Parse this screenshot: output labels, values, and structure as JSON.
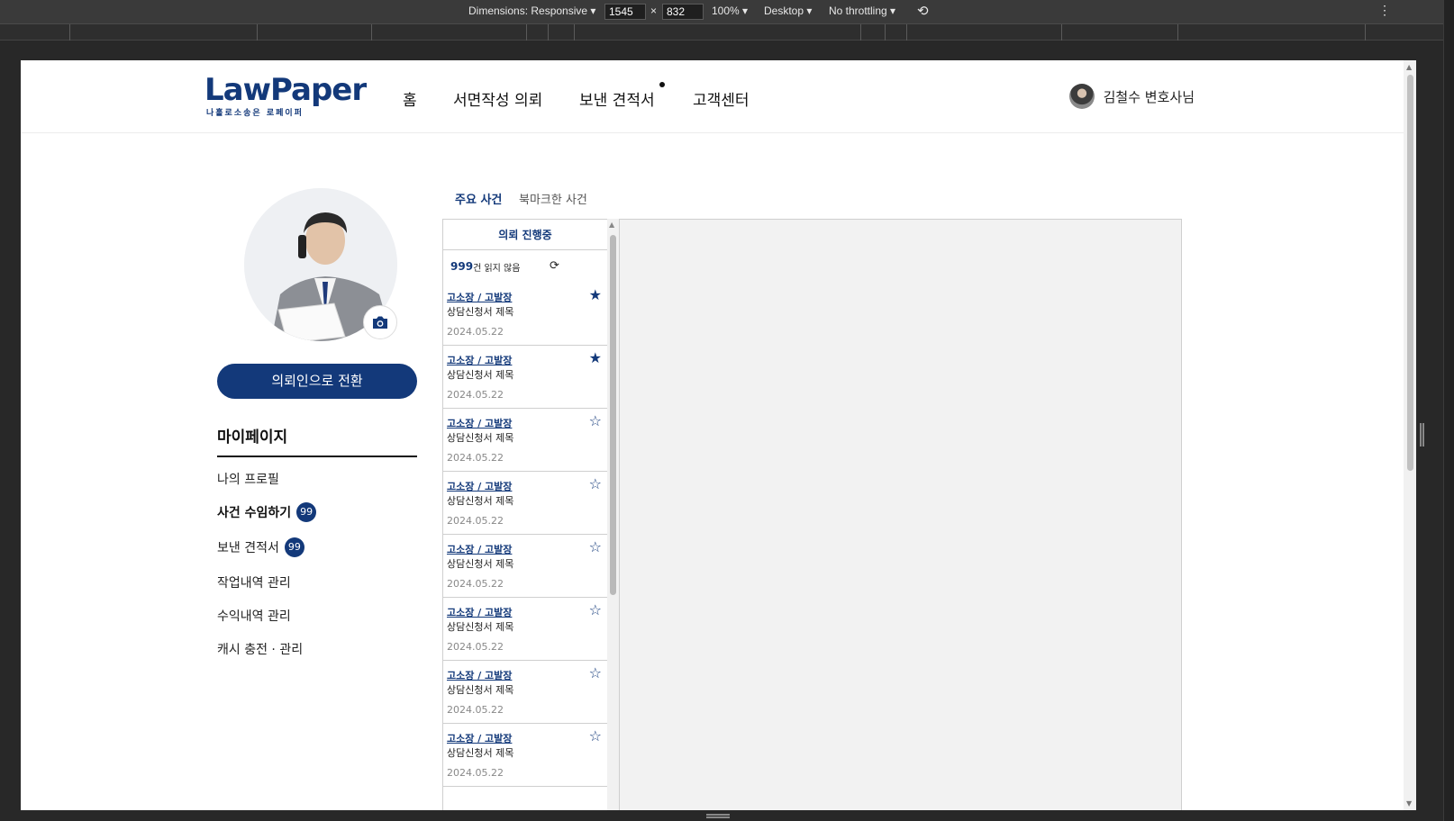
{
  "devtools": {
    "dimensions_label": "Dimensions: Responsive",
    "width": "1545",
    "times": "×",
    "height": "832",
    "zoom": "100%",
    "device": "Desktop",
    "throttling": "No throttling"
  },
  "header": {
    "logo_text": "LawPaper",
    "logo_sub": "나홀로소송은 로페이퍼",
    "nav": [
      "홈",
      "서면작성 의뢰",
      "보낸 견적서",
      "고객센터"
    ],
    "user_name": "김철수 변호사님"
  },
  "sidebar": {
    "switch_button": "의뢰인으로 전환",
    "title": "마이페이지",
    "items": [
      {
        "label": "나의 프로필"
      },
      {
        "label": "사건 수임하기",
        "badge": "99"
      },
      {
        "label": "보낸 견적서",
        "badge": "99"
      },
      {
        "label": "작업내역 관리"
      },
      {
        "label": "수익내역 관리"
      },
      {
        "label": "캐시 충전 · 관리"
      }
    ]
  },
  "tabs": [
    "주요 사건",
    "북마크한 사건"
  ],
  "case_list": {
    "header": "의뢰 진행중",
    "unread_count": "999",
    "unread_suffix": "건 읽지 않음",
    "cases": [
      {
        "category": "고소장 / 고발장",
        "title": "상담신청서 제목",
        "date": "2024.05.22",
        "starred": true
      },
      {
        "category": "고소장 / 고발장",
        "title": "상담신청서 제목",
        "date": "2024.05.22",
        "starred": true
      },
      {
        "category": "고소장 / 고발장",
        "title": "상담신청서 제목",
        "date": "2024.05.22",
        "starred": false
      },
      {
        "category": "고소장 / 고발장",
        "title": "상담신청서 제목",
        "date": "2024.05.22",
        "starred": false
      },
      {
        "category": "고소장 / 고발장",
        "title": "상담신청서 제목",
        "date": "2024.05.22",
        "starred": false
      },
      {
        "category": "고소장 / 고발장",
        "title": "상담신청서 제목",
        "date": "2024.05.22",
        "starred": false
      },
      {
        "category": "고소장 / 고발장",
        "title": "상담신청서 제목",
        "date": "2024.05.22",
        "starred": false
      },
      {
        "category": "고소장 / 고발장",
        "title": "상담신청서 제목",
        "date": "2024.05.22",
        "starred": false
      }
    ]
  },
  "colors": {
    "brand": "#13397a",
    "devtools_bg": "#3a3a3a"
  }
}
